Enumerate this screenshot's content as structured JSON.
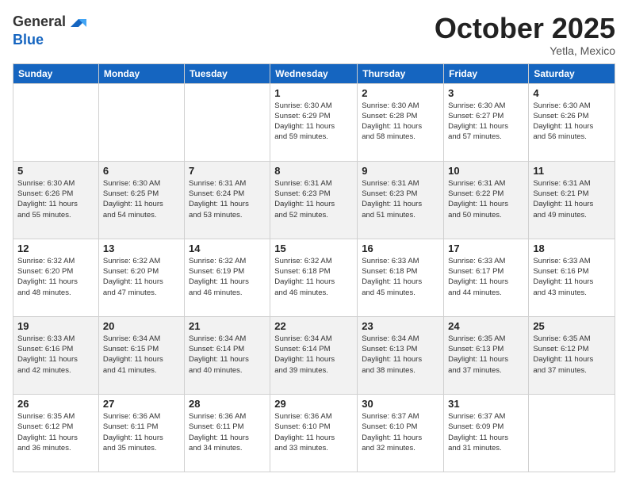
{
  "header": {
    "logo_general": "General",
    "logo_blue": "Blue",
    "month_title": "October 2025",
    "location": "Yetla, Mexico"
  },
  "weekdays": [
    "Sunday",
    "Monday",
    "Tuesday",
    "Wednesday",
    "Thursday",
    "Friday",
    "Saturday"
  ],
  "weeks": [
    [
      {
        "day": "",
        "info": ""
      },
      {
        "day": "",
        "info": ""
      },
      {
        "day": "",
        "info": ""
      },
      {
        "day": "1",
        "info": "Sunrise: 6:30 AM\nSunset: 6:29 PM\nDaylight: 11 hours\nand 59 minutes."
      },
      {
        "day": "2",
        "info": "Sunrise: 6:30 AM\nSunset: 6:28 PM\nDaylight: 11 hours\nand 58 minutes."
      },
      {
        "day": "3",
        "info": "Sunrise: 6:30 AM\nSunset: 6:27 PM\nDaylight: 11 hours\nand 57 minutes."
      },
      {
        "day": "4",
        "info": "Sunrise: 6:30 AM\nSunset: 6:26 PM\nDaylight: 11 hours\nand 56 minutes."
      }
    ],
    [
      {
        "day": "5",
        "info": "Sunrise: 6:30 AM\nSunset: 6:26 PM\nDaylight: 11 hours\nand 55 minutes."
      },
      {
        "day": "6",
        "info": "Sunrise: 6:30 AM\nSunset: 6:25 PM\nDaylight: 11 hours\nand 54 minutes."
      },
      {
        "day": "7",
        "info": "Sunrise: 6:31 AM\nSunset: 6:24 PM\nDaylight: 11 hours\nand 53 minutes."
      },
      {
        "day": "8",
        "info": "Sunrise: 6:31 AM\nSunset: 6:23 PM\nDaylight: 11 hours\nand 52 minutes."
      },
      {
        "day": "9",
        "info": "Sunrise: 6:31 AM\nSunset: 6:23 PM\nDaylight: 11 hours\nand 51 minutes."
      },
      {
        "day": "10",
        "info": "Sunrise: 6:31 AM\nSunset: 6:22 PM\nDaylight: 11 hours\nand 50 minutes."
      },
      {
        "day": "11",
        "info": "Sunrise: 6:31 AM\nSunset: 6:21 PM\nDaylight: 11 hours\nand 49 minutes."
      }
    ],
    [
      {
        "day": "12",
        "info": "Sunrise: 6:32 AM\nSunset: 6:20 PM\nDaylight: 11 hours\nand 48 minutes."
      },
      {
        "day": "13",
        "info": "Sunrise: 6:32 AM\nSunset: 6:20 PM\nDaylight: 11 hours\nand 47 minutes."
      },
      {
        "day": "14",
        "info": "Sunrise: 6:32 AM\nSunset: 6:19 PM\nDaylight: 11 hours\nand 46 minutes."
      },
      {
        "day": "15",
        "info": "Sunrise: 6:32 AM\nSunset: 6:18 PM\nDaylight: 11 hours\nand 46 minutes."
      },
      {
        "day": "16",
        "info": "Sunrise: 6:33 AM\nSunset: 6:18 PM\nDaylight: 11 hours\nand 45 minutes."
      },
      {
        "day": "17",
        "info": "Sunrise: 6:33 AM\nSunset: 6:17 PM\nDaylight: 11 hours\nand 44 minutes."
      },
      {
        "day": "18",
        "info": "Sunrise: 6:33 AM\nSunset: 6:16 PM\nDaylight: 11 hours\nand 43 minutes."
      }
    ],
    [
      {
        "day": "19",
        "info": "Sunrise: 6:33 AM\nSunset: 6:16 PM\nDaylight: 11 hours\nand 42 minutes."
      },
      {
        "day": "20",
        "info": "Sunrise: 6:34 AM\nSunset: 6:15 PM\nDaylight: 11 hours\nand 41 minutes."
      },
      {
        "day": "21",
        "info": "Sunrise: 6:34 AM\nSunset: 6:14 PM\nDaylight: 11 hours\nand 40 minutes."
      },
      {
        "day": "22",
        "info": "Sunrise: 6:34 AM\nSunset: 6:14 PM\nDaylight: 11 hours\nand 39 minutes."
      },
      {
        "day": "23",
        "info": "Sunrise: 6:34 AM\nSunset: 6:13 PM\nDaylight: 11 hours\nand 38 minutes."
      },
      {
        "day": "24",
        "info": "Sunrise: 6:35 AM\nSunset: 6:13 PM\nDaylight: 11 hours\nand 37 minutes."
      },
      {
        "day": "25",
        "info": "Sunrise: 6:35 AM\nSunset: 6:12 PM\nDaylight: 11 hours\nand 37 minutes."
      }
    ],
    [
      {
        "day": "26",
        "info": "Sunrise: 6:35 AM\nSunset: 6:12 PM\nDaylight: 11 hours\nand 36 minutes."
      },
      {
        "day": "27",
        "info": "Sunrise: 6:36 AM\nSunset: 6:11 PM\nDaylight: 11 hours\nand 35 minutes."
      },
      {
        "day": "28",
        "info": "Sunrise: 6:36 AM\nSunset: 6:11 PM\nDaylight: 11 hours\nand 34 minutes."
      },
      {
        "day": "29",
        "info": "Sunrise: 6:36 AM\nSunset: 6:10 PM\nDaylight: 11 hours\nand 33 minutes."
      },
      {
        "day": "30",
        "info": "Sunrise: 6:37 AM\nSunset: 6:10 PM\nDaylight: 11 hours\nand 32 minutes."
      },
      {
        "day": "31",
        "info": "Sunrise: 6:37 AM\nSunset: 6:09 PM\nDaylight: 11 hours\nand 31 minutes."
      },
      {
        "day": "",
        "info": ""
      }
    ]
  ]
}
